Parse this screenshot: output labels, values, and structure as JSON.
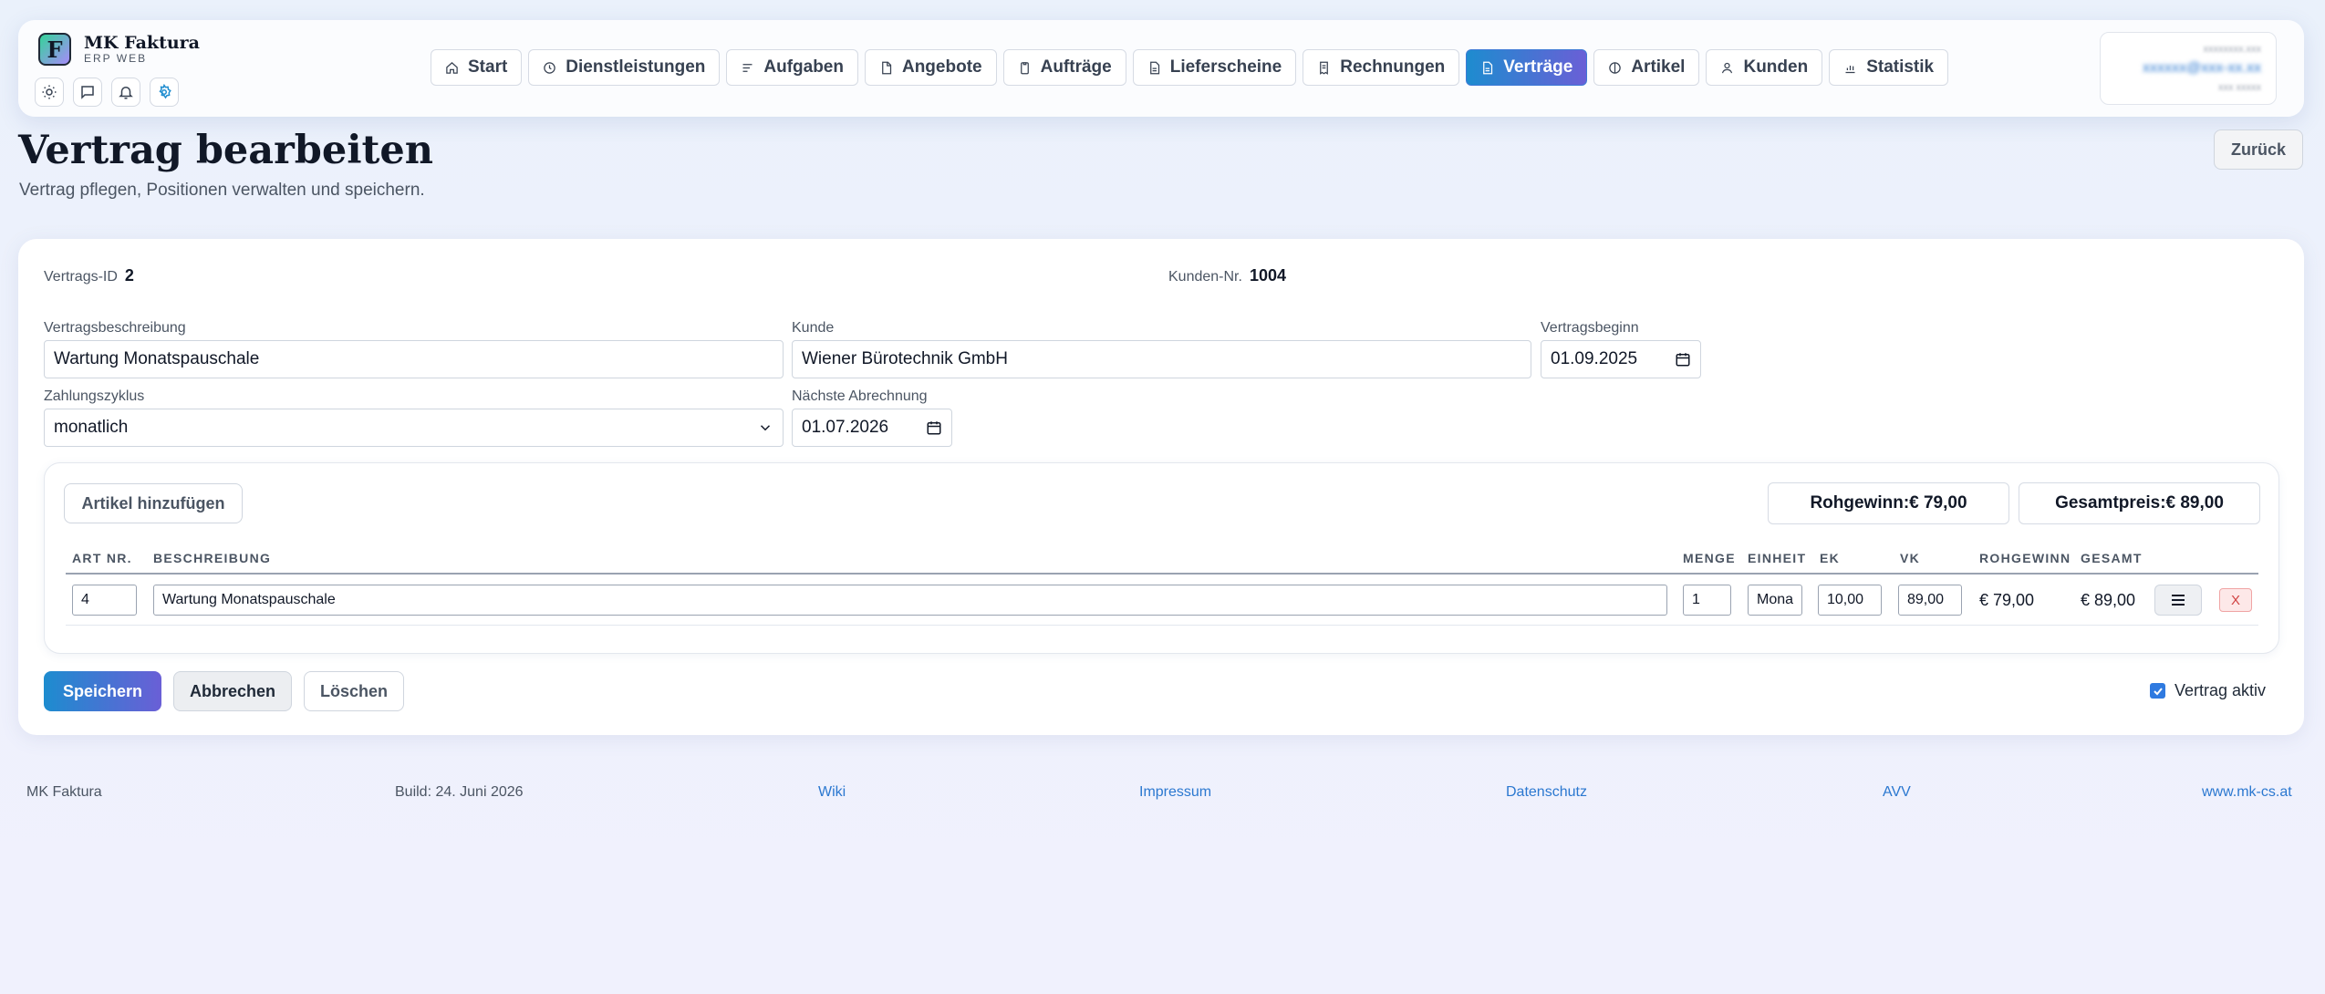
{
  "brand": {
    "name": "MK Faktura",
    "sub": "ERP WEB",
    "logo_letter": "F"
  },
  "quick_icons": [
    "sun-icon",
    "chat-icon",
    "bell-icon",
    "gear-icon"
  ],
  "nav": [
    {
      "label": "Start",
      "icon": "home-icon",
      "active": false
    },
    {
      "label": "Dienstleistungen",
      "icon": "clock-icon",
      "active": false
    },
    {
      "label": "Aufgaben",
      "icon": "list-icon",
      "active": false
    },
    {
      "label": "Angebote",
      "icon": "document-icon",
      "active": false
    },
    {
      "label": "Aufträge",
      "icon": "clipboard-icon",
      "active": false
    },
    {
      "label": "Lieferscheine",
      "icon": "document-icon",
      "active": false
    },
    {
      "label": "Rechnungen",
      "icon": "receipt-icon",
      "active": false
    },
    {
      "label": "Verträge",
      "icon": "contract-icon",
      "active": true
    },
    {
      "label": "Artikel",
      "icon": "tag-icon",
      "active": false
    },
    {
      "label": "Kunden",
      "icon": "user-icon",
      "active": false
    },
    {
      "label": "Statistik",
      "icon": "chart-icon",
      "active": false
    }
  ],
  "user": {
    "line1": "xxxxxxxx.xxx",
    "line2": "xxxxxx@xxx-xx.xx",
    "line3": "xxx xxxxx"
  },
  "page": {
    "title": "Vertrag bearbeiten",
    "subtitle": "Vertrag pflegen, Positionen verwalten und speichern.",
    "back_label": "Zurück"
  },
  "contract": {
    "id_label": "Vertrags-ID",
    "id_value": "2",
    "customer_no_label": "Kunden-Nr.",
    "customer_no_value": "1004",
    "description_label": "Vertragsbeschreibung",
    "description_value": "Wartung Monatspauschale",
    "customer_label": "Kunde",
    "customer_value": "Wiener Bürotechnik GmbH",
    "start_label": "Vertragsbeginn",
    "start_value": "01.09.2025",
    "cycle_label": "Zahlungszyklus",
    "cycle_value": "monatlich",
    "next_billing_label": "Nächste Abrechnung",
    "next_billing_value": "01.07.2026"
  },
  "positions": {
    "add_label": "Artikel hinzufügen",
    "gross_profit_label": "Rohgewinn:€ 79,00",
    "total_label": "Gesamtpreis:€ 89,00",
    "columns": [
      "ART NR.",
      "BESCHREIBUNG",
      "MENGE",
      "EINHEIT",
      "EK",
      "VK",
      "ROHGEWINN",
      "GESAMT"
    ],
    "rows": [
      {
        "art_nr": "4",
        "description": "Wartung Monatspauschale",
        "qty": "1",
        "unit": "Mona",
        "ek": "10,00",
        "vk": "89,00",
        "gross_profit": "€ 79,00",
        "total": "€ 89,00",
        "delete_label": "X"
      }
    ]
  },
  "actions": {
    "save": "Speichern",
    "cancel": "Abbrechen",
    "delete": "Löschen",
    "active_label": "Vertrag aktiv",
    "active_checked": true
  },
  "footer": {
    "app": "MK Faktura",
    "build": "Build: 24. Juni 2026",
    "wiki": "Wiki",
    "imprint": "Impressum",
    "privacy": "Datenschutz",
    "avv": "AVV",
    "website": "www.mk-cs.at"
  },
  "colors": {
    "accent_start": "#1d8ccf",
    "accent_end": "#6a5fd6",
    "link": "#2b78d0",
    "danger": "#d14343"
  }
}
